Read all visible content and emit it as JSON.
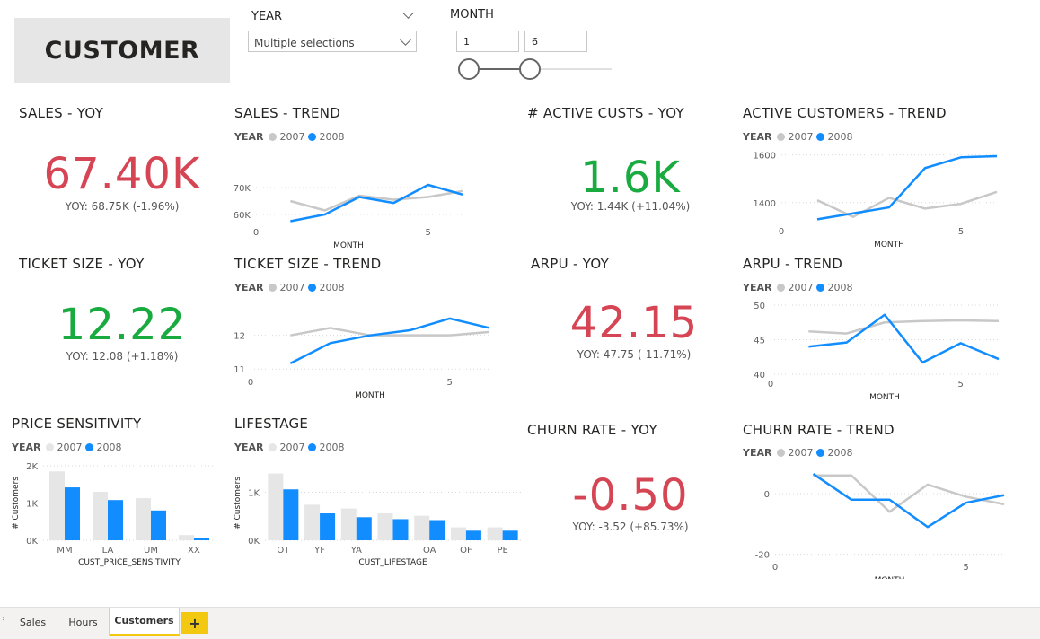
{
  "page_title": "CUSTOMER",
  "colors": {
    "y2007": "#c8c8c8",
    "y2008": "#118dff",
    "good": "#1aab40",
    "bad": "#d64554",
    "bar2007": "#e6e6e6"
  },
  "slicers": {
    "year": {
      "label": "YEAR",
      "value": "Multiple selections"
    },
    "month": {
      "label": "MONTH",
      "min": "1",
      "max": "6",
      "range_min_fraction": 0,
      "range_max_fraction": 0.43
    }
  },
  "legend": {
    "title": "YEAR",
    "a": "2007",
    "b": "2008"
  },
  "kpis": {
    "sales": {
      "title": "SALES - YOY",
      "value": "67.40K",
      "sub": "YOY: 68.75K (-1.96%)",
      "color": "#d64554"
    },
    "active": {
      "title": "# ACTIVE CUSTS - YOY",
      "value": "1.6K",
      "sub": "YOY: 1.44K (+11.04%)",
      "color": "#1aab40"
    },
    "ticket": {
      "title": "TICKET SIZE - YOY",
      "value": "12.22",
      "sub": "YOY: 12.08 (+1.18%)",
      "color": "#1aab40"
    },
    "arpu": {
      "title": "ARPU - YOY",
      "value": "42.15",
      "sub": "YOY: 47.75 (-11.71%)",
      "color": "#d64554"
    },
    "churn": {
      "title": "CHURN RATE - YOY",
      "value": "-0.50",
      "sub": "YOY: -3.52 (+85.73%)",
      "color": "#d64554"
    }
  },
  "trend_titles": {
    "sales": "SALES - TREND",
    "active": "ACTIVE CUSTOMERS - TREND",
    "ticket": "TICKET SIZE - TREND",
    "arpu": "ARPU - TREND",
    "churn": "CHURN RATE - TREND",
    "price": "PRICE SENSITIVITY",
    "life": "LIFESTAGE"
  },
  "chart_data": [
    {
      "id": "sales",
      "type": "line",
      "title": "SALES - TREND",
      "xlabel": "MONTH",
      "ylabel": "",
      "x": [
        1,
        2,
        3,
        4,
        5,
        6
      ],
      "xlim": [
        0,
        6
      ],
      "ylim": [
        57000,
        72000
      ],
      "yticks": [
        60000,
        70000
      ],
      "ytick_labels": [
        "60K",
        "70K"
      ],
      "xticks": [
        0,
        5
      ],
      "series": [
        {
          "name": "2007",
          "values": [
            65000,
            61500,
            67000,
            65500,
            66500,
            68700
          ]
        },
        {
          "name": "2008",
          "values": [
            57500,
            60000,
            66500,
            64300,
            71000,
            67400
          ]
        }
      ]
    },
    {
      "id": "active",
      "type": "line",
      "title": "ACTIVE CUSTOMERS - TREND",
      "xlabel": "MONTH",
      "ylabel": "",
      "x": [
        1,
        2,
        3,
        4,
        5,
        6
      ],
      "xlim": [
        0,
        6
      ],
      "ylim": [
        1320,
        1610
      ],
      "yticks": [
        1400,
        1600
      ],
      "ytick_labels": [
        "1400",
        "1600"
      ],
      "xticks": [
        0,
        5
      ],
      "series": [
        {
          "name": "2007",
          "values": [
            1410,
            1340,
            1420,
            1375,
            1395,
            1445
          ]
        },
        {
          "name": "2008",
          "values": [
            1330,
            1355,
            1380,
            1545,
            1590,
            1595
          ]
        }
      ]
    },
    {
      "id": "ticket",
      "type": "line",
      "title": "TICKET SIZE - TREND",
      "xlabel": "MONTH",
      "ylabel": "",
      "x": [
        1,
        2,
        3,
        4,
        5,
        6
      ],
      "xlim": [
        0,
        6
      ],
      "ylim": [
        10.9,
        12.95
      ],
      "yticks": [
        11,
        12
      ],
      "ytick_labels": [
        "11",
        "12"
      ],
      "xticks": [
        0,
        5
      ],
      "series": [
        {
          "name": "2007",
          "values": [
            12.0,
            12.22,
            12.0,
            12.0,
            12.0,
            12.1
          ]
        },
        {
          "name": "2008",
          "values": [
            11.17,
            11.77,
            12.0,
            12.15,
            12.5,
            12.22
          ]
        }
      ]
    },
    {
      "id": "arpu",
      "type": "line",
      "title": "ARPU - TREND",
      "xlabel": "MONTH",
      "ylabel": "",
      "x": [
        1,
        2,
        3,
        4,
        5,
        6
      ],
      "xlim": [
        0,
        6
      ],
      "ylim": [
        40,
        50
      ],
      "yticks": [
        40,
        45,
        50
      ],
      "ytick_labels": [
        "40",
        "45",
        "50"
      ],
      "xticks": [
        0,
        5
      ],
      "series": [
        {
          "name": "2007",
          "values": [
            46.2,
            45.9,
            47.5,
            47.7,
            47.8,
            47.7
          ]
        },
        {
          "name": "2008",
          "values": [
            44.0,
            44.6,
            48.6,
            41.7,
            44.5,
            42.2
          ]
        }
      ]
    },
    {
      "id": "churn",
      "type": "line",
      "title": "CHURN RATE - TREND",
      "xlabel": "MONTH",
      "ylabel": "",
      "x": [
        1,
        2,
        3,
        4,
        5,
        6
      ],
      "xlim": [
        0,
        6
      ],
      "ylim": [
        -21,
        8
      ],
      "yticks": [
        0,
        -20
      ],
      "ytick_labels": [
        "0",
        "-20"
      ],
      "xticks": [
        0,
        5
      ],
      "series": [
        {
          "name": "2007",
          "values": [
            6,
            6,
            -6,
            3,
            -1,
            -3.5
          ]
        },
        {
          "name": "2008",
          "values": [
            6.5,
            -2,
            -2,
            -11,
            -3,
            -0.5
          ]
        }
      ]
    },
    {
      "id": "price",
      "type": "bar",
      "title": "PRICE SENSITIVITY",
      "xlabel": "CUST_PRICE_SENSITIVITY",
      "ylabel": "# Customers",
      "categories": [
        "MM",
        "LA",
        "UM",
        "XX"
      ],
      "ylim": [
        0,
        2000
      ],
      "yticks": [
        0,
        1000,
        2000
      ],
      "ytick_labels": [
        "0K",
        "1K",
        "2K"
      ],
      "series": [
        {
          "name": "2007",
          "values": [
            1850,
            1300,
            1130,
            140
          ]
        },
        {
          "name": "2008",
          "values": [
            1420,
            1080,
            800,
            70
          ]
        }
      ]
    },
    {
      "id": "life",
      "type": "bar",
      "title": "LIFESTAGE",
      "xlabel": "CUST_LIFESTAGE",
      "ylabel": "# Customers",
      "categories": [
        "OT",
        "YF",
        "YA",
        "",
        "OA",
        "OF",
        "PE"
      ],
      "ylim": [
        0,
        1550
      ],
      "yticks": [
        0,
        1000
      ],
      "ytick_labels": [
        "0K",
        "1K"
      ],
      "series": [
        {
          "name": "2007",
          "values": [
            1390,
            740,
            660,
            560,
            510,
            270,
            270
          ]
        },
        {
          "name": "2008",
          "values": [
            1060,
            560,
            480,
            440,
            420,
            200,
            200
          ]
        }
      ]
    }
  ],
  "tabs": [
    {
      "label": "Sales",
      "active": false
    },
    {
      "label": "Hours",
      "active": false
    },
    {
      "label": "Customers",
      "active": true
    }
  ],
  "tab_add": "+",
  "tab_nav": "›"
}
